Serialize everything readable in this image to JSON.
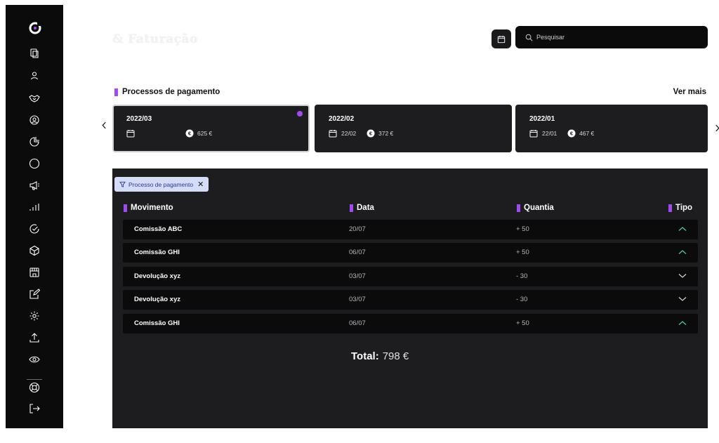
{
  "sidebar": {
    "logo": "brand-logo",
    "items": [
      {
        "icon": "documents-icon"
      },
      {
        "icon": "user-icon"
      },
      {
        "icon": "handshake-icon"
      },
      {
        "icon": "user-search-icon"
      },
      {
        "icon": "pie-chart-icon"
      },
      {
        "icon": "circle-icon"
      },
      {
        "icon": "megaphone-icon"
      },
      {
        "icon": "signal-bars-icon"
      },
      {
        "icon": "check-circle-icon"
      },
      {
        "icon": "box-icon"
      },
      {
        "icon": "store-icon"
      },
      {
        "icon": "edit-icon"
      },
      {
        "icon": "settings-icon"
      },
      {
        "icon": "upload-icon"
      },
      {
        "icon": "eye-icon"
      }
    ],
    "bottom": [
      {
        "icon": "support-icon"
      },
      {
        "icon": "logout-icon"
      }
    ]
  },
  "header": {
    "title": "& Faturação",
    "search_placeholder": "Pesquisar"
  },
  "payments": {
    "section_title": "Processos de pagamento",
    "see_more": "Ver mais",
    "cards": [
      {
        "period": "2022/03",
        "date": "",
        "amount": "625 €",
        "active": true
      },
      {
        "period": "2022/02",
        "date": "22/02",
        "amount": "372 €",
        "active": false
      },
      {
        "period": "2022/01",
        "date": "22/01",
        "amount": "467 €",
        "active": false
      }
    ]
  },
  "table": {
    "filter_chip": "Processo de pagamento",
    "columns": [
      "Movimento",
      "Data",
      "Quantia",
      "Tipo"
    ],
    "rows": [
      {
        "movement": "Comissão ABC",
        "date": "20/07",
        "amount": "+ 50",
        "type": "up"
      },
      {
        "movement": "Comissão GHI",
        "date": "06/07",
        "amount": "+ 50",
        "type": "up"
      },
      {
        "movement": "Devolução xyz",
        "date": "03/07",
        "amount": "- 30",
        "type": "down"
      },
      {
        "movement": "Devolução xyz",
        "date": "03/07",
        "amount": "- 30",
        "type": "down"
      },
      {
        "movement": "Comissão GHI",
        "date": "06/07",
        "amount": "+ 50",
        "type": "up"
      }
    ],
    "total_label": "Total:",
    "total_value": "798 €"
  },
  "colors": {
    "accent": "#a04bf0",
    "positive": "#4fd1a5",
    "negative": "#d8d8d8",
    "panel": "#1d1d20",
    "dark": "#0b0b0c"
  }
}
